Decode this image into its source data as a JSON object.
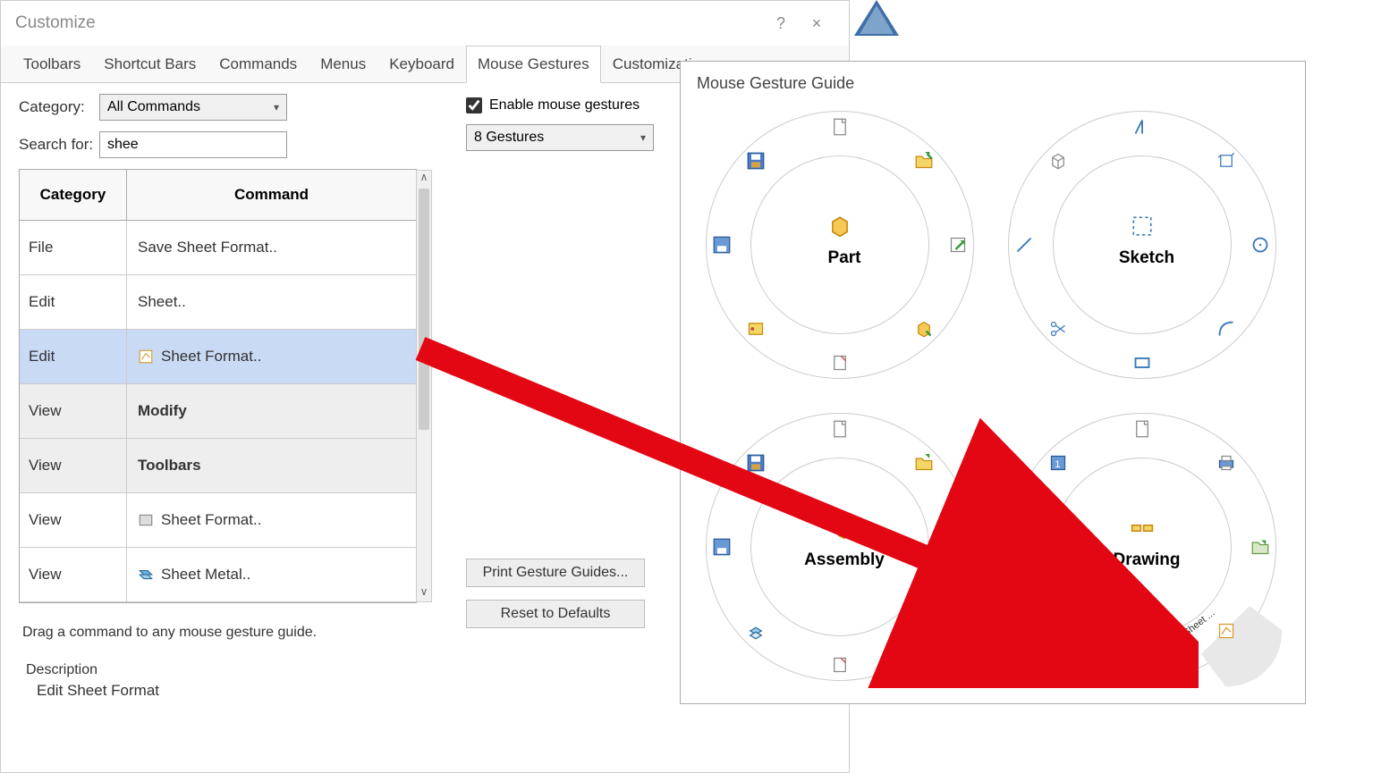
{
  "dialog": {
    "title": "Customize",
    "help": "?",
    "close": "×"
  },
  "tabs": [
    "Toolbars",
    "Shortcut Bars",
    "Commands",
    "Menus",
    "Keyboard",
    "Mouse Gestures",
    "Customization"
  ],
  "active_tab": "Mouse Gestures",
  "category": {
    "label": "Category:",
    "value": "All Commands"
  },
  "search": {
    "label": "Search for:",
    "value": "shee"
  },
  "enable_checkbox": {
    "label": "Enable mouse gestures",
    "checked": true
  },
  "gesture_count": {
    "value": "8 Gestures"
  },
  "table": {
    "headers": {
      "category": "Category",
      "command": "Command"
    },
    "rows": [
      {
        "cat": "File",
        "cmd": "Save Sheet Format..",
        "icon": "",
        "group": false,
        "selected": false
      },
      {
        "cat": "Edit",
        "cmd": "Sheet..",
        "icon": "",
        "group": false,
        "selected": false
      },
      {
        "cat": "Edit",
        "cmd": "Sheet Format..",
        "icon": "sheet-format-icon",
        "group": false,
        "selected": true
      },
      {
        "cat": "View",
        "cmd": "Modify",
        "icon": "",
        "group": true,
        "selected": false
      },
      {
        "cat": "View",
        "cmd": "Toolbars",
        "icon": "",
        "group": true,
        "selected": false
      },
      {
        "cat": "View",
        "cmd": "Sheet Format..",
        "icon": "sheet-gray-icon",
        "group": false,
        "selected": false
      },
      {
        "cat": "View",
        "cmd": "Sheet Metal..",
        "icon": "sheet-metal-icon",
        "group": false,
        "selected": false
      }
    ]
  },
  "hint": "Drag a command to any mouse gesture guide.",
  "description_label": "Description",
  "description_text": "Edit Sheet Format",
  "buttons": {
    "print": "Print Gesture Guides...",
    "reset": "Reset to Defaults"
  },
  "guide": {
    "title": "Mouse Gesture Guide",
    "wheels": [
      {
        "label": "Part"
      },
      {
        "label": "Sketch"
      },
      {
        "label": "Assembly"
      },
      {
        "label": "Drawing"
      }
    ],
    "drawing_save_label": "Save Sheet ..."
  },
  "colors": {
    "arrow": "#e30613",
    "selected_row": "#c9daf5"
  }
}
